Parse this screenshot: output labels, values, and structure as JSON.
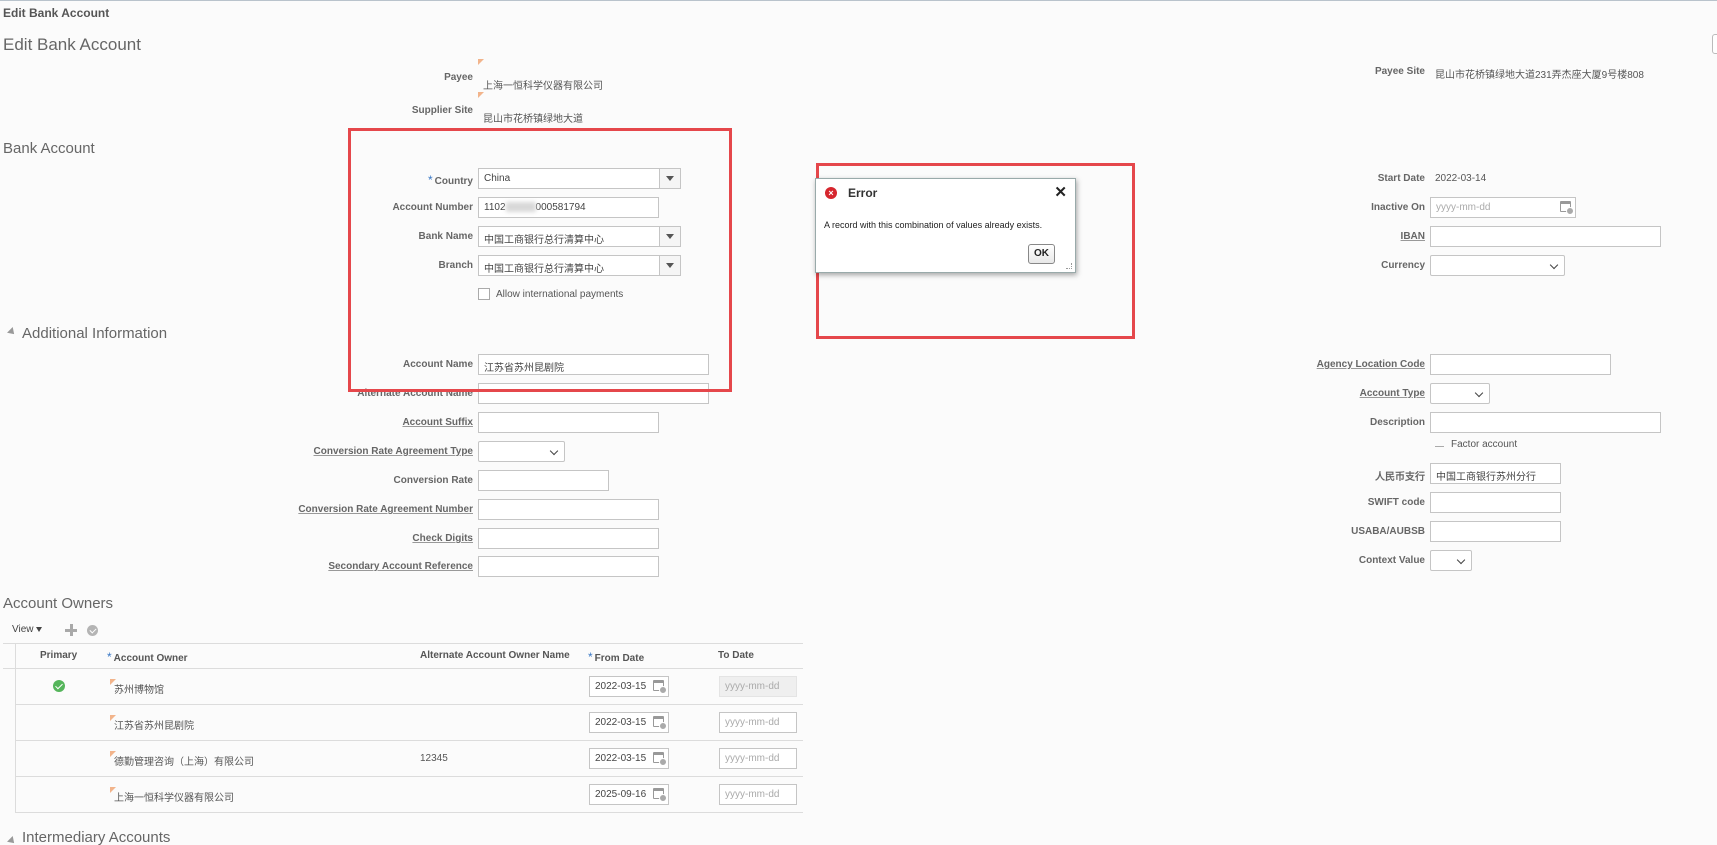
{
  "breadcrumb": "Edit Bank Account",
  "page_title": "Edit Bank Account",
  "payee": {
    "label": "Payee",
    "value": "上海一恒科学仪器有限公司"
  },
  "supplier_site": {
    "label": "Supplier Site",
    "value": "昆山市花桥镇绿地大道"
  },
  "payee_site": {
    "label": "Payee Site",
    "value": "昆山市花桥镇绿地大道231弄杰座大厦9号楼808"
  },
  "sections": {
    "bank_account": "Bank Account",
    "additional_information": "Additional Information",
    "account_owners": "Account Owners",
    "intermediary_accounts": "Intermediary Accounts"
  },
  "bank_account": {
    "country": {
      "label": "Country",
      "value": "China"
    },
    "account_number": {
      "label": "Account Number",
      "value_prefix": "1102",
      "value_suffix": "000581794"
    },
    "bank_name": {
      "label": "Bank Name",
      "value": "中国工商银行总行清算中心"
    },
    "branch": {
      "label": "Branch",
      "value": "中国工商银行总行清算中心"
    },
    "allow_international": "Allow international payments",
    "start_date": {
      "label": "Start Date",
      "value": "2022-03-14"
    },
    "inactive_on": {
      "label": "Inactive On",
      "placeholder": "yyyy-mm-dd"
    },
    "iban": {
      "label": "IBAN"
    },
    "currency": {
      "label": "Currency"
    }
  },
  "additional": {
    "account_name": {
      "label": "Account Name",
      "value": "江苏省苏州昆剧院"
    },
    "alternate_account_name": {
      "label": "Alternate Account Name"
    },
    "account_suffix": {
      "label": "Account Suffix"
    },
    "conv_rate_agreement_type": {
      "label": "Conversion Rate Agreement Type"
    },
    "conversion_rate": {
      "label": "Conversion Rate"
    },
    "conv_rate_agreement_number": {
      "label": "Conversion Rate Agreement Number"
    },
    "check_digits": {
      "label": "Check Digits"
    },
    "secondary_account_reference": {
      "label": "Secondary Account Reference"
    },
    "agency_location_code": {
      "label": "Agency Location Code"
    },
    "account_type": {
      "label": "Account Type"
    },
    "description": {
      "label": "Description"
    },
    "factor_account": "Factor account",
    "rmb_branch": {
      "label": "人民币支行",
      "value": "中国工商银行苏州分行"
    },
    "swift_code": {
      "label": "SWIFT code"
    },
    "usaba": {
      "label": "USABA/AUBSB"
    },
    "context_value": {
      "label": "Context Value"
    }
  },
  "error_dialog": {
    "title": "Error",
    "message": "A record with this combination of values already exists.",
    "ok": "OK",
    "close": "✕"
  },
  "owners_toolbar": {
    "view": "View"
  },
  "owners_table": {
    "headers": {
      "primary": "Primary",
      "owner": "Account Owner",
      "alt_name": "Alternate Account Owner Name",
      "from_date": "From Date",
      "to_date": "To Date"
    },
    "to_placeholder": "yyyy-mm-dd",
    "rows": [
      {
        "owner": "苏州博物馆",
        "alt": "",
        "from": "2022-03-15",
        "primary": true
      },
      {
        "owner": "江苏省苏州昆剧院",
        "alt": "",
        "from": "2022-03-15",
        "primary": false
      },
      {
        "owner": "德勤管理咨询（上海）有限公司",
        "alt": "12345",
        "from": "2022-03-15",
        "primary": false
      },
      {
        "owner": "上海一恒科学仪器有限公司",
        "alt": "",
        "from": "2025-09-16",
        "primary": false
      }
    ]
  },
  "colors": {
    "highlight": "#e5474b",
    "error": "#d6262e",
    "required": "#3a78c5",
    "success": "#55b55b"
  }
}
